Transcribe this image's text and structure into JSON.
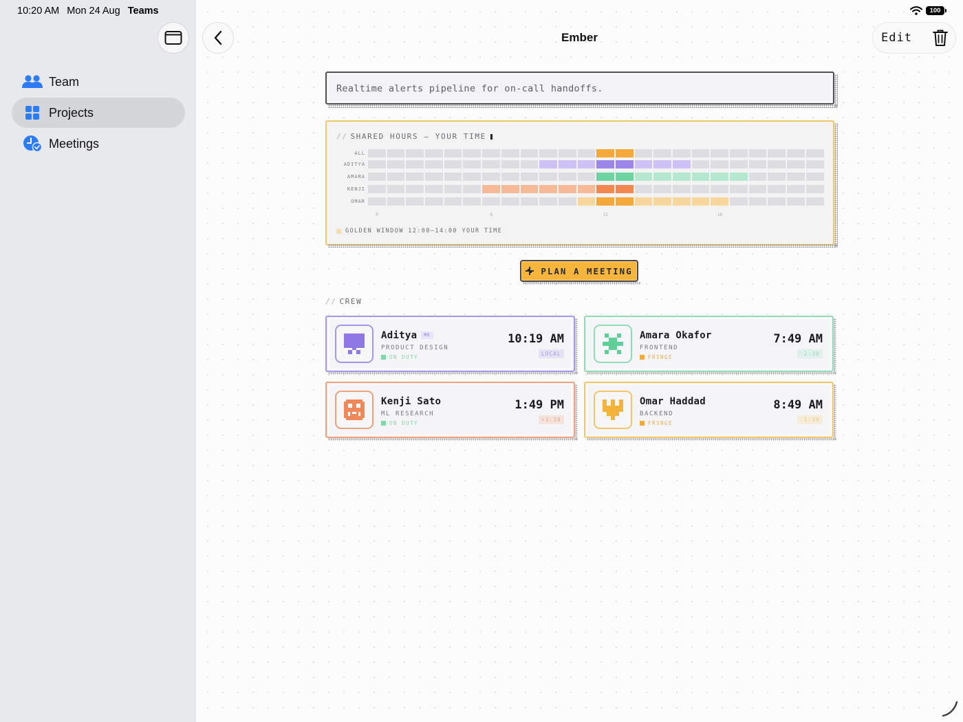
{
  "status": {
    "time": "10:20 AM",
    "date": "Mon 24 Aug",
    "app": "Teams",
    "battery": "100"
  },
  "sidebar": {
    "items": [
      {
        "label": "Team",
        "icon": "people-icon",
        "active": false
      },
      {
        "label": "Projects",
        "icon": "grid-icon",
        "active": true
      },
      {
        "label": "Meetings",
        "icon": "clock-check-icon",
        "active": false
      }
    ]
  },
  "header": {
    "title": "Ember",
    "edit_label": "Edit"
  },
  "description": "Realtime alerts pipeline for on-call handoffs.",
  "hours": {
    "title_prefix": "//",
    "title": "SHARED HOURS — YOUR TIME",
    "rows": [
      {
        "label": "ALL",
        "cells": [
          0,
          0,
          0,
          0,
          0,
          0,
          0,
          0,
          0,
          0,
          0,
          0,
          2,
          2,
          0,
          0,
          0,
          0,
          0,
          0,
          0,
          0,
          0,
          0
        ],
        "color": "#f4a93a",
        "light": "#f8d58a"
      },
      {
        "label": "ADITYA",
        "cells": [
          0,
          0,
          0,
          0,
          0,
          0,
          0,
          0,
          0,
          1,
          1,
          1,
          2,
          2,
          1,
          1,
          1,
          0,
          0,
          0,
          0,
          0,
          0,
          0
        ],
        "color": "#9d86ea",
        "light": "#cdc1f6"
      },
      {
        "label": "AMARA",
        "cells": [
          0,
          0,
          0,
          0,
          0,
          0,
          0,
          0,
          0,
          0,
          0,
          0,
          2,
          2,
          1,
          1,
          1,
          1,
          1,
          1,
          0,
          0,
          0,
          0
        ],
        "color": "#6cd3a1",
        "light": "#b5e9cf"
      },
      {
        "label": "KENJI",
        "cells": [
          0,
          0,
          0,
          0,
          0,
          0,
          1,
          1,
          1,
          1,
          1,
          1,
          2,
          2,
          0,
          0,
          0,
          0,
          0,
          0,
          0,
          0,
          0,
          0
        ],
        "color": "#f0884f",
        "light": "#f5b997"
      },
      {
        "label": "OMAR",
        "cells": [
          0,
          0,
          0,
          0,
          0,
          0,
          0,
          0,
          0,
          0,
          0,
          1,
          2,
          2,
          1,
          1,
          1,
          1,
          1,
          0,
          0,
          0,
          0,
          0
        ],
        "color": "#f4a93a",
        "light": "#f7d79b"
      }
    ],
    "ticks": [
      "0",
      "6",
      "12",
      "18"
    ],
    "golden_window": "GOLDEN WINDOW 12:00–14:00 YOUR TIME"
  },
  "plan_button": "PLAN A MEETING",
  "crew": {
    "label_prefix": "//",
    "label": "CREW",
    "members": [
      {
        "name": "Aditya",
        "me_badge": "ME",
        "role": "PRODUCT DESIGN",
        "status": "ON DUTY",
        "time": "10:19 AM",
        "offset": "LOCAL",
        "accent": "#a795ec",
        "status_color": "#7fd8a7"
      },
      {
        "name": "Amara Okafor",
        "me_badge": "",
        "role": "FRONTEND",
        "status": "FRINGE",
        "time": "7:49 AM",
        "offset": "-2:30",
        "accent": "#8fdcb7",
        "status_color": "#f4a93a"
      },
      {
        "name": "Kenji Sato",
        "me_badge": "",
        "role": "ML RESEARCH",
        "status": "ON DUTY",
        "time": "1:49 PM",
        "offset": "+3:30",
        "accent": "#f0a07a",
        "status_color": "#7fd8a7"
      },
      {
        "name": "Omar Haddad",
        "me_badge": "",
        "role": "BACKEND",
        "status": "FRINGE",
        "time": "8:49 AM",
        "offset": "-1:30",
        "accent": "#f3c766",
        "status_color": "#f4a93a"
      }
    ]
  }
}
